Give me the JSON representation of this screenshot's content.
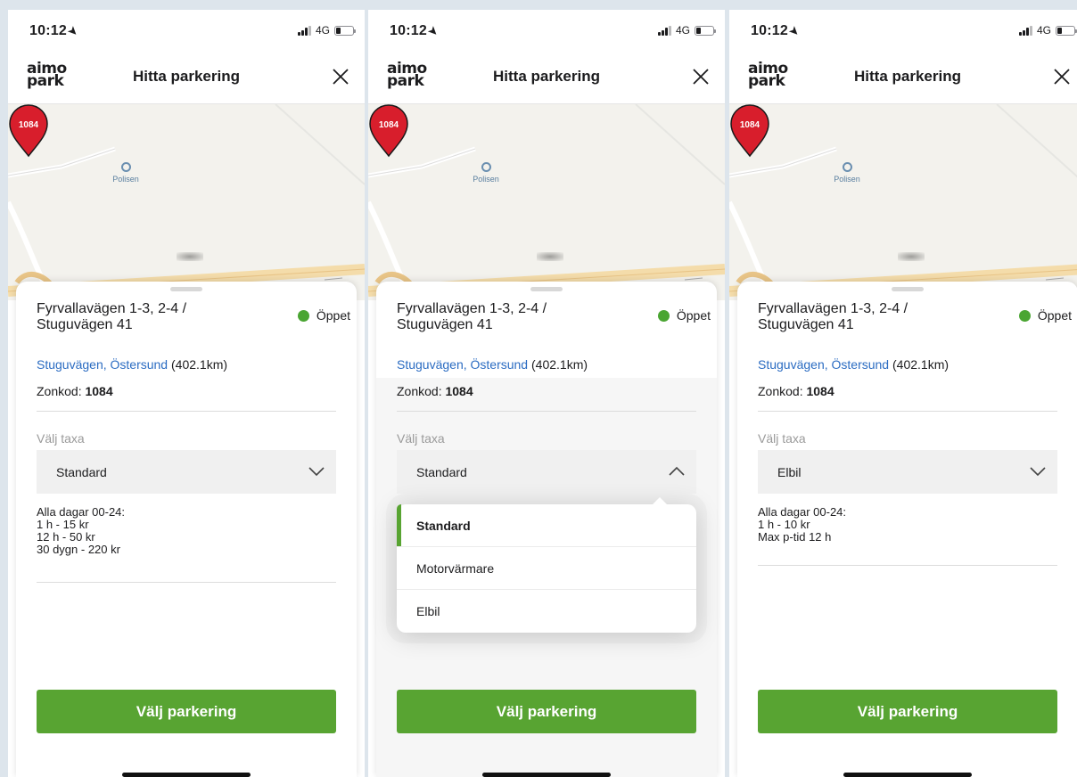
{
  "status_bar": {
    "time": "10:12",
    "network": "4G"
  },
  "header": {
    "logo_line1": "aimo",
    "logo_line2": "park",
    "title": "Hitta parkering"
  },
  "map": {
    "poi_label": "Polisen",
    "pin_label": "1084"
  },
  "screens": [
    {
      "address_line1": "Fyrvallavägen 1-3, 2-4 /",
      "address_line2": "Stuguvägen 41",
      "status_label": "Öppet",
      "area_link": "Stuguvägen, Östersund",
      "distance": "(402.1km)",
      "zone_label": "Zonkod:",
      "zone_code": "1084",
      "taxa_label": "Välj taxa",
      "selected_taxa": "Standard",
      "price_lines": [
        "Alla dagar 00-24:",
        "1 h - 15 kr",
        "12 h - 50 kr",
        "30 dygn - 220 kr"
      ],
      "cta_label": "Välj parkering"
    },
    {
      "address_line1": "Fyrvallavägen 1-3, 2-4 /",
      "address_line2": "Stuguvägen 41",
      "status_label": "Öppet",
      "area_link": "Stuguvägen, Östersund",
      "distance": "(402.1km)",
      "zone_label": "Zonkod:",
      "zone_code": "1084",
      "taxa_label": "Välj taxa",
      "selected_taxa": "Standard",
      "dropdown_options": [
        "Standard",
        "Motorvärmare",
        "Elbil"
      ],
      "cta_label": "Välj parkering"
    },
    {
      "address_line1": "Fyrvallavägen 1-3, 2-4 /",
      "address_line2": "Stuguvägen 41",
      "status_label": "Öppet",
      "area_link": "Stuguvägen, Östersund",
      "distance": "(402.1km)",
      "zone_label": "Zonkod:",
      "zone_code": "1084",
      "taxa_label": "Välj taxa",
      "selected_taxa": "Elbil",
      "price_lines": [
        "Alla dagar 00-24:",
        "1 h - 10 kr",
        "Max p-tid 12 h"
      ],
      "cta_label": "Välj parkering"
    }
  ],
  "colors": {
    "accent_green": "#58a432",
    "status_green": "#4aa532",
    "link_blue": "#2b6cc2",
    "pin_red": "#d81e2c"
  }
}
